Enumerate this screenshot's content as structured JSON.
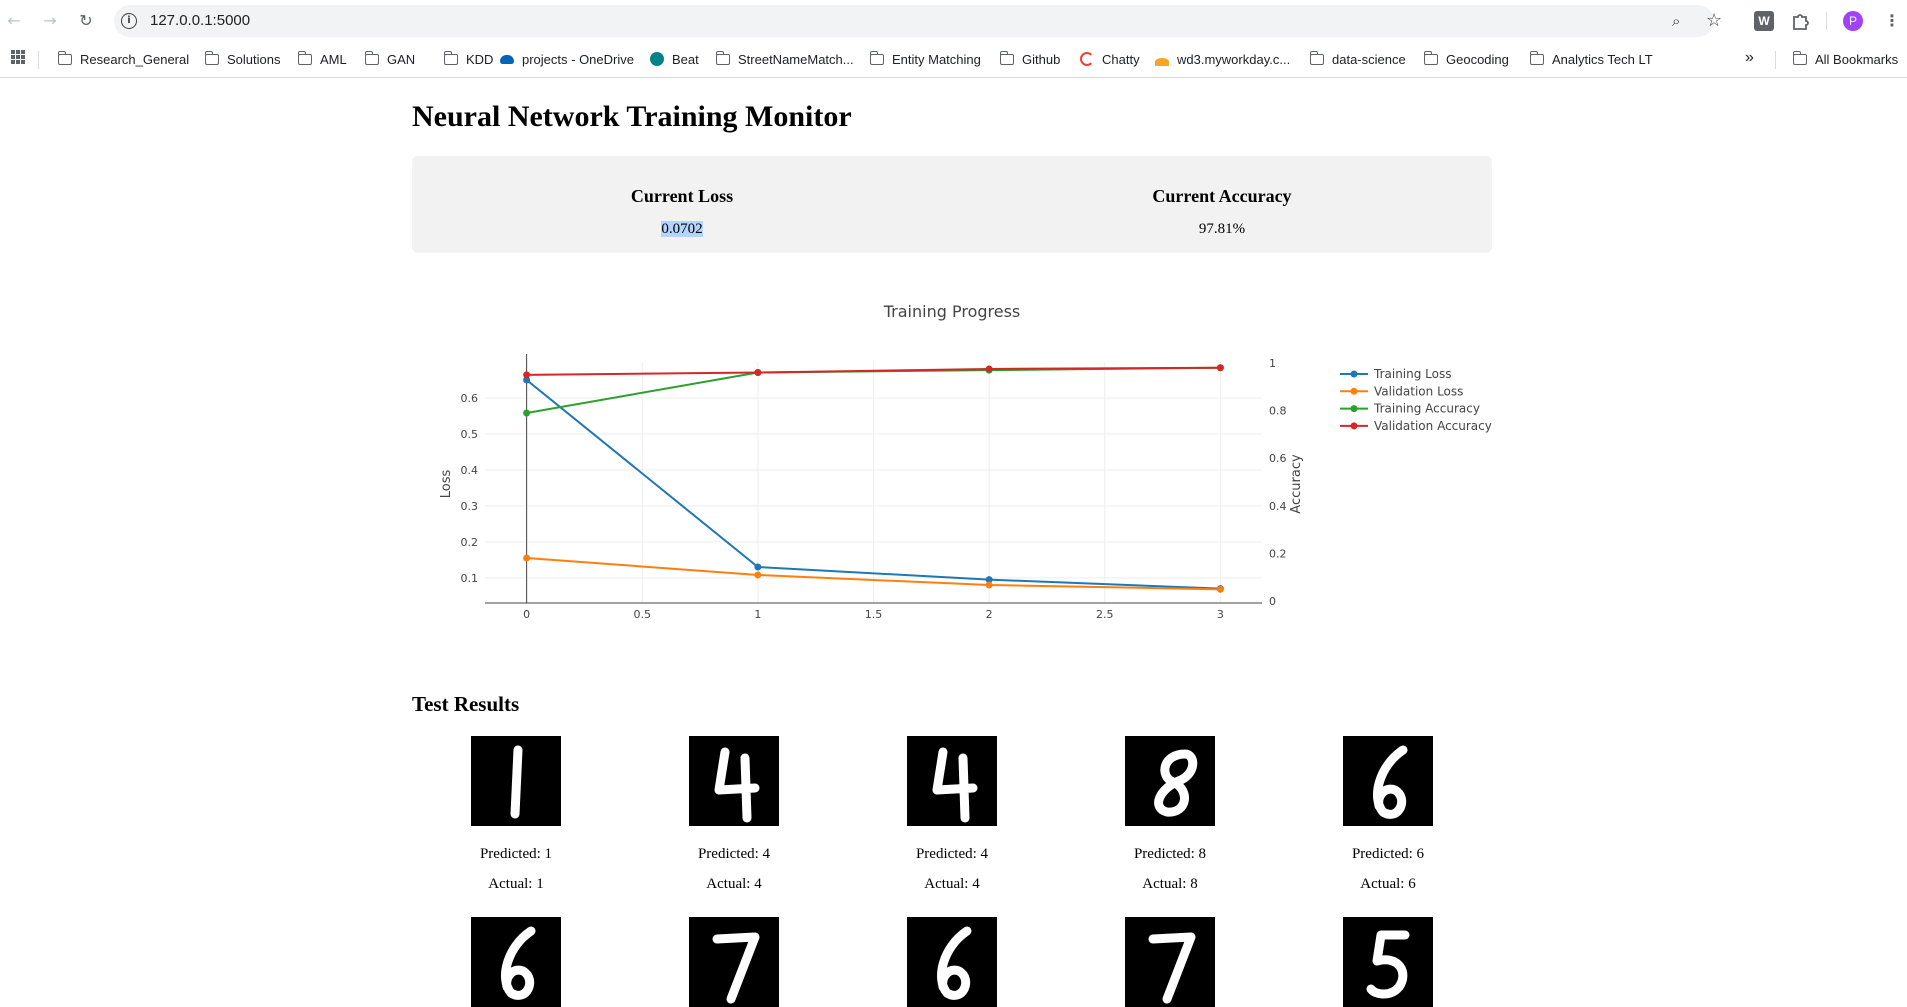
{
  "browser": {
    "url": "127.0.0.1:5000",
    "avatar_letter": "P",
    "ext_w": "W",
    "bookmarks": [
      {
        "label": "Research_General",
        "icon": "folder-icon"
      },
      {
        "label": "Solutions",
        "icon": "folder-icon"
      },
      {
        "label": "AML",
        "icon": "folder-icon"
      },
      {
        "label": "GAN",
        "icon": "folder-icon"
      },
      {
        "label": "KDD",
        "icon": "folder-icon"
      },
      {
        "label": "projects - OneDrive",
        "icon": "onedrive-icon"
      },
      {
        "label": "Beat",
        "icon": "sharepoint-icon"
      },
      {
        "label": "StreetNameMatch...",
        "icon": "folder-icon"
      },
      {
        "label": "Entity Matching",
        "icon": "folder-icon"
      },
      {
        "label": "Github",
        "icon": "folder-icon"
      },
      {
        "label": "Chatty",
        "icon": "google-icon"
      },
      {
        "label": "wd3.myworkday.c...",
        "icon": "workday-icon"
      },
      {
        "label": "data-science",
        "icon": "folder-icon"
      },
      {
        "label": "Geocoding",
        "icon": "folder-icon"
      },
      {
        "label": "Analytics Tech LT",
        "icon": "folder-icon"
      }
    ],
    "all_bookmarks": "All Bookmarks"
  },
  "page": {
    "title": "Neural Network Training Monitor",
    "loss_label": "Current Loss",
    "loss_value": "0.0702",
    "acc_label": "Current Accuracy",
    "acc_value": "97.81%",
    "results_title": "Test Results"
  },
  "chart_data": {
    "type": "line",
    "title": "Training Progress",
    "x": [
      0,
      1,
      2,
      3
    ],
    "xlim": [
      -0.18,
      3.18
    ],
    "xticks": [
      "0",
      "0.5",
      "1",
      "1.5",
      "2",
      "2.5",
      "3"
    ],
    "ylabel": "Loss",
    "ylim": [
      0.03,
      0.7
    ],
    "yticks": [
      "0.1",
      "0.2",
      "0.3",
      "0.4",
      "0.5",
      "0.6"
    ],
    "y2label": "Accuracy",
    "y2lim": [
      0,
      1
    ],
    "y2ticks": [
      "0",
      "0.2",
      "0.4",
      "0.6",
      "0.8",
      "1"
    ],
    "legend_position": "right",
    "series": [
      {
        "name": "Training Loss",
        "axis": "y",
        "color": "#1f77b4",
        "values": [
          0.65,
          0.13,
          0.095,
          0.07
        ]
      },
      {
        "name": "Validation Loss",
        "axis": "y",
        "color": "#ff7f0e",
        "values": [
          0.155,
          0.108,
          0.08,
          0.068
        ]
      },
      {
        "name": "Training Accuracy",
        "axis": "y2",
        "color": "#2ca02c",
        "values": [
          0.79,
          0.96,
          0.97,
          0.98
        ]
      },
      {
        "name": "Validation Accuracy",
        "axis": "y2",
        "color": "#d62728",
        "values": [
          0.95,
          0.96,
          0.975,
          0.98
        ]
      }
    ]
  },
  "results": [
    {
      "predicted": "Predicted: 1",
      "actual": "Actual: 1",
      "digit": "1"
    },
    {
      "predicted": "Predicted: 4",
      "actual": "Actual: 4",
      "digit": "4"
    },
    {
      "predicted": "Predicted: 4",
      "actual": "Actual: 4",
      "digit": "4"
    },
    {
      "predicted": "Predicted: 8",
      "actual": "Actual: 8",
      "digit": "8"
    },
    {
      "predicted": "Predicted: 6",
      "actual": "Actual: 6",
      "digit": "6"
    },
    {
      "digit": "6"
    },
    {
      "digit": "7"
    },
    {
      "digit": "6"
    },
    {
      "digit": "7"
    },
    {
      "digit": "5"
    }
  ]
}
